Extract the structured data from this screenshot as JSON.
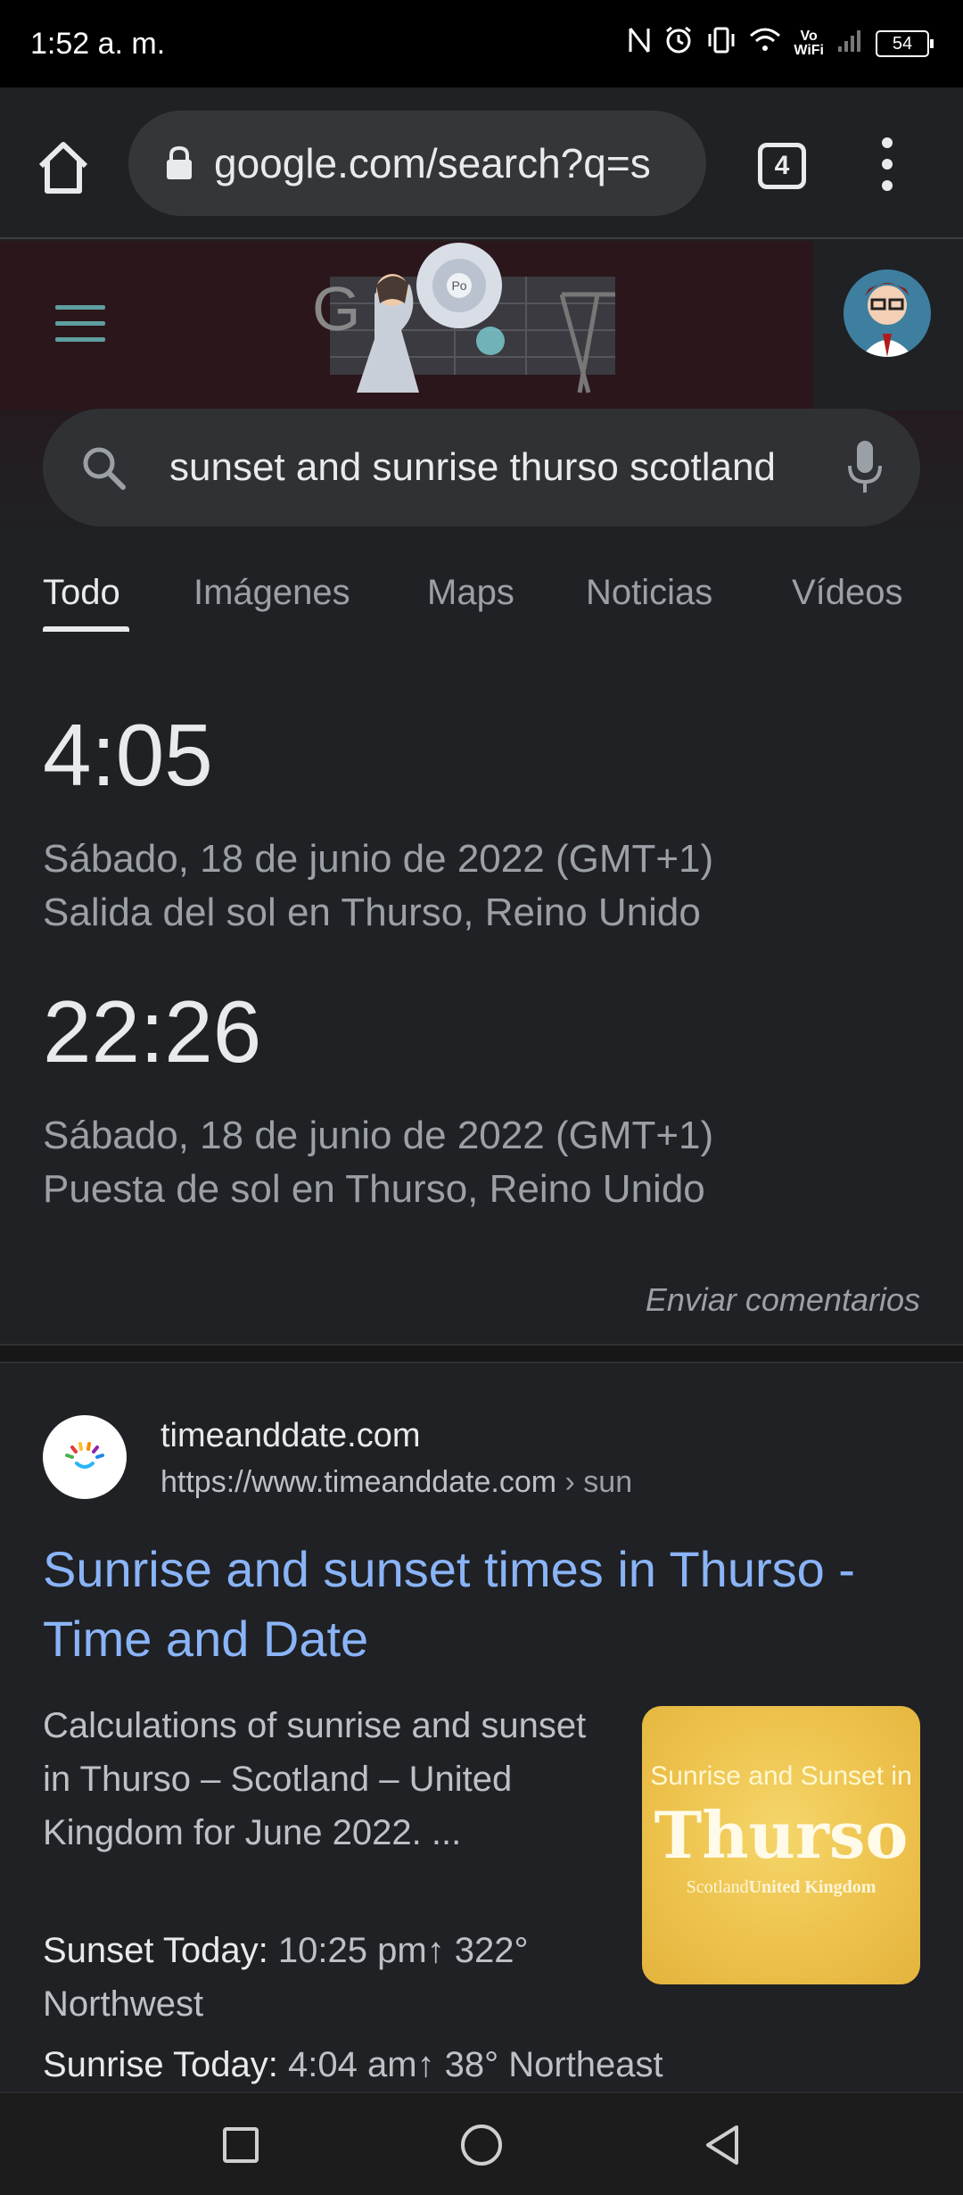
{
  "status_bar": {
    "time": "1:52 a. m.",
    "vowifi_top": "Vo",
    "vowifi_bottom": "WiFi",
    "battery": "54"
  },
  "toolbar": {
    "url": "google.com/search?q=s",
    "tab_count": "4"
  },
  "search": {
    "query": "sunset and sunrise thurso scotland"
  },
  "tabs": [
    {
      "label": "Todo",
      "active": true
    },
    {
      "label": "Imágenes",
      "active": false
    },
    {
      "label": "Maps",
      "active": false
    },
    {
      "label": "Noticias",
      "active": false
    },
    {
      "label": "Vídeos",
      "active": false
    }
  ],
  "sun_card": {
    "sunrise_time": "4:05",
    "sunrise_date": "Sábado, 18 de junio de 2022 (GMT+1)",
    "sunrise_label": "Salida del sol en Thurso, Reino Unido",
    "sunset_time": "22:26",
    "sunset_date": "Sábado, 18 de junio de 2022 (GMT+1)",
    "sunset_label": "Puesta de sol en Thurso, Reino Unido",
    "feedback": "Enviar comentarios"
  },
  "result": {
    "site_name": "timeanddate.com",
    "site_url": "https://www.timeanddate.com",
    "breadcrumb": " › sun",
    "title": "Sunrise and sunset times in Thurso - Time and Date",
    "snippet": "Calculations of sunrise and sunset in Thurso – Scotland – United Kingdom for June 2022. ...",
    "thumbnail": {
      "top_text": "Sunrise and Sunset in",
      "main_text": "Thurso",
      "sub_left": "Scotland",
      "sub_right": "United Kingdom"
    },
    "facts": [
      {
        "key": "Sunset Today:",
        "value": " 10:25 pm↑ 322° Northwest"
      },
      {
        "key": "Sunrise Today:",
        "value": " 4:04 am↑ 38° Northeast"
      }
    ]
  },
  "colors": {
    "background": "#202124",
    "link": "#8ab4f8",
    "secondary_text": "#9aa0a6"
  }
}
